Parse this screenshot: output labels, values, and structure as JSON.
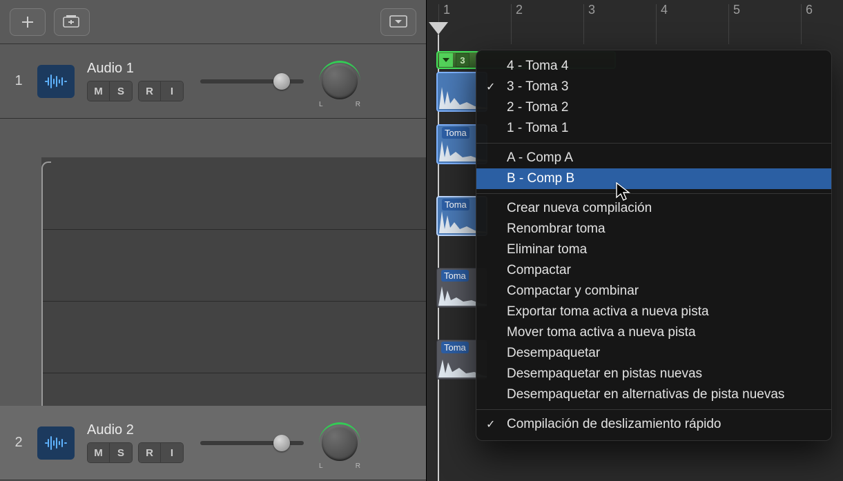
{
  "toolbar": {
    "add_label": "+",
    "add_track_label": "+track"
  },
  "ruler": {
    "bars": [
      "1",
      "2",
      "3",
      "4",
      "5",
      "6"
    ]
  },
  "tracks": [
    {
      "index": "1",
      "name": "Audio 1",
      "buttons": {
        "m": "M",
        "s": "S",
        "r": "R",
        "i": "I"
      },
      "pan": {
        "left": "L",
        "right": "R"
      }
    },
    {
      "index": "2",
      "name": "Audio 2",
      "buttons": {
        "m": "M",
        "s": "S",
        "r": "R",
        "i": "I"
      },
      "pan": {
        "left": "L",
        "right": "R"
      }
    }
  ],
  "region": {
    "comp_selected": "3"
  },
  "take_lanes": [
    {
      "label": "Toma",
      "selected": false,
      "clip": "sel"
    },
    {
      "label": "Toma",
      "selected": true,
      "clip": "sel"
    },
    {
      "label": "Toma",
      "selected": false,
      "clip": "unsel"
    },
    {
      "label": "Toma",
      "selected": false,
      "clip": "unsel"
    }
  ],
  "menu": {
    "takes": [
      {
        "label": "4 - Toma 4",
        "checked": false
      },
      {
        "label": "3 - Toma 3",
        "checked": true
      },
      {
        "label": "2 - Toma 2",
        "checked": false
      },
      {
        "label": "1 - Toma 1",
        "checked": false
      }
    ],
    "comps": [
      {
        "label": "A - Comp A",
        "highlight": false
      },
      {
        "label": "B - Comp B",
        "highlight": true
      }
    ],
    "actions": [
      "Crear nueva compilación",
      "Renombrar toma",
      "Eliminar toma",
      "Compactar",
      "Compactar y combinar",
      "Exportar toma activa a nueva pista",
      "Mover toma activa a nueva pista",
      "Desempaquetar",
      "Desempaquetar en pistas nuevas",
      "Desempaquetar en alternativas de pista nuevas"
    ],
    "footer": {
      "label": "Compilación de deslizamiento rápido",
      "checked": true
    }
  }
}
